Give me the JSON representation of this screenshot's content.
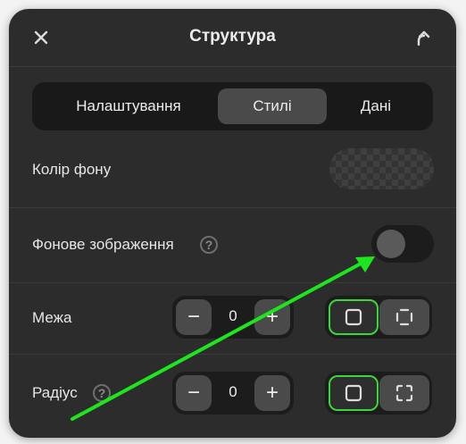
{
  "header": {
    "title": "Структура"
  },
  "tabs": [
    {
      "label": "Налаштування",
      "active": false
    },
    {
      "label": "Стилі",
      "active": true
    },
    {
      "label": "Дані",
      "active": false
    }
  ],
  "background_color": {
    "label": "Колір фону"
  },
  "background_image": {
    "label": "Фонове зображення",
    "help": "?",
    "toggle_on": false
  },
  "border": {
    "label": "Межа",
    "value": "0",
    "minus": "−",
    "plus": "+"
  },
  "radius": {
    "label": "Радіус",
    "help": "?",
    "value": "0",
    "minus": "−",
    "plus": "+"
  },
  "colors": {
    "panel": "#2c2c2c",
    "accent_selected": "#3bd63b",
    "annotation_arrow": "#1ee61e"
  }
}
